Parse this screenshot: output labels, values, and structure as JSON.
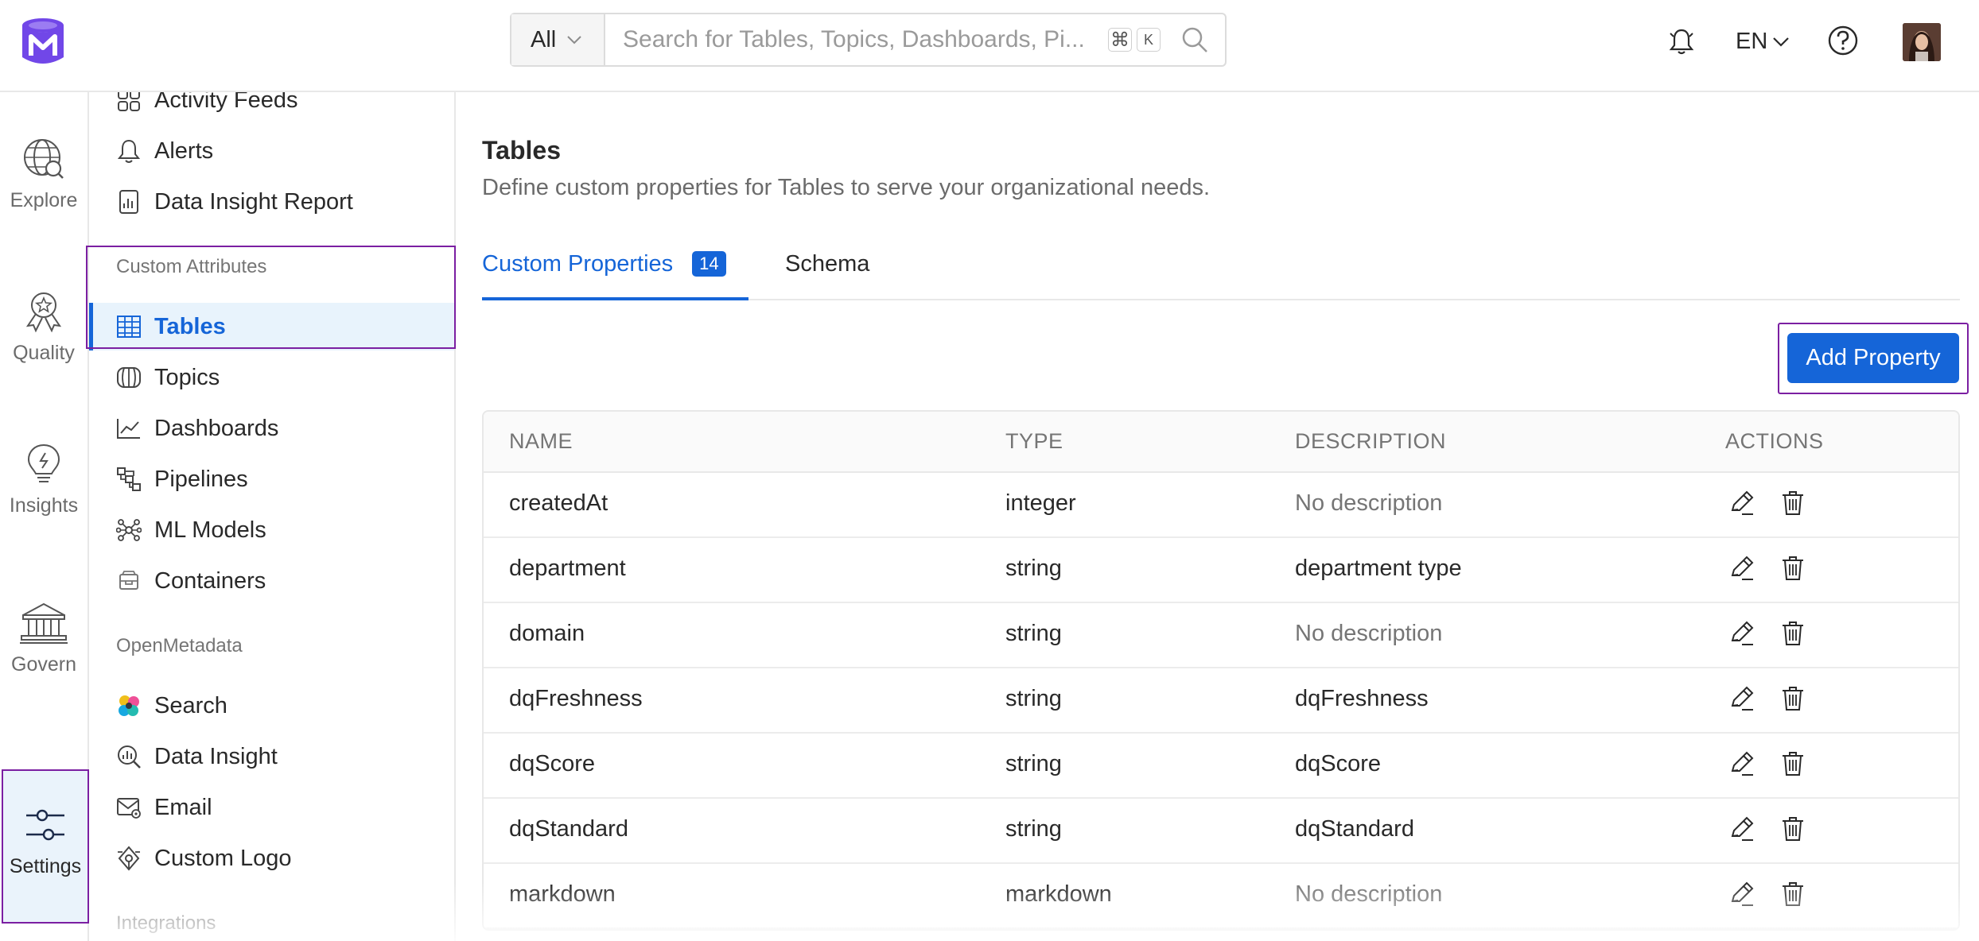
{
  "header": {
    "search_scope": "All",
    "search_placeholder": "Search for Tables, Topics, Dashboards, Pi...",
    "shortcut_keys": [
      "⌘",
      "K"
    ],
    "language": "EN"
  },
  "rail": {
    "items": [
      {
        "label": "Explore",
        "icon": "globe-search-icon"
      },
      {
        "label": "Quality",
        "icon": "award-icon"
      },
      {
        "label": "Insights",
        "icon": "lightbulb-icon"
      },
      {
        "label": "Govern",
        "icon": "bank-icon"
      },
      {
        "label": "Settings",
        "icon": "sliders-icon",
        "active": true
      }
    ]
  },
  "menu": {
    "top_items": [
      {
        "label": "Activity Feeds",
        "icon": "grid-icon"
      },
      {
        "label": "Alerts",
        "icon": "bell-icon"
      },
      {
        "label": "Data Insight Report",
        "icon": "report-icon"
      }
    ],
    "group_custom_attributes": "Custom Attributes",
    "custom_items": [
      {
        "label": "Tables",
        "icon": "table-icon",
        "active": true
      },
      {
        "label": "Topics",
        "icon": "topic-icon"
      },
      {
        "label": "Dashboards",
        "icon": "chart-line-icon"
      },
      {
        "label": "Pipelines",
        "icon": "pipeline-icon"
      },
      {
        "label": "ML Models",
        "icon": "ml-model-icon"
      },
      {
        "label": "Containers",
        "icon": "container-icon"
      }
    ],
    "group_openmetadata": "OpenMetadata",
    "om_items": [
      {
        "label": "Search",
        "icon": "elastic-search-icon"
      },
      {
        "label": "Data Insight",
        "icon": "data-insight-icon"
      },
      {
        "label": "Email",
        "icon": "email-settings-icon"
      },
      {
        "label": "Custom Logo",
        "icon": "custom-logo-icon"
      }
    ],
    "group_integrations": "Integrations"
  },
  "main": {
    "title": "Tables",
    "subtitle": "Define custom properties for Tables to serve your organizational needs.",
    "tabs": [
      {
        "label": "Custom Properties",
        "count": "14",
        "active": true
      },
      {
        "label": "Schema"
      }
    ],
    "add_button": "Add Property",
    "columns": [
      "NAME",
      "TYPE",
      "DESCRIPTION",
      "ACTIONS"
    ],
    "rows": [
      {
        "name": "createdAt",
        "type": "integer",
        "description": "No description",
        "empty": true
      },
      {
        "name": "department",
        "type": "string",
        "description": "department type",
        "empty": false
      },
      {
        "name": "domain",
        "type": "string",
        "description": "No description",
        "empty": true
      },
      {
        "name": "dqFreshness",
        "type": "string",
        "description": "dqFreshness",
        "empty": false
      },
      {
        "name": "dqScore",
        "type": "string",
        "description": "dqScore",
        "empty": false
      },
      {
        "name": "dqStandard",
        "type": "string",
        "description": "dqStandard",
        "empty": false
      },
      {
        "name": "markdown",
        "type": "markdown",
        "description": "No description",
        "empty": true
      }
    ]
  },
  "colors": {
    "primary": "#1565d8",
    "highlight": "#7b1fa2",
    "active_bg": "#e8f3fc"
  }
}
